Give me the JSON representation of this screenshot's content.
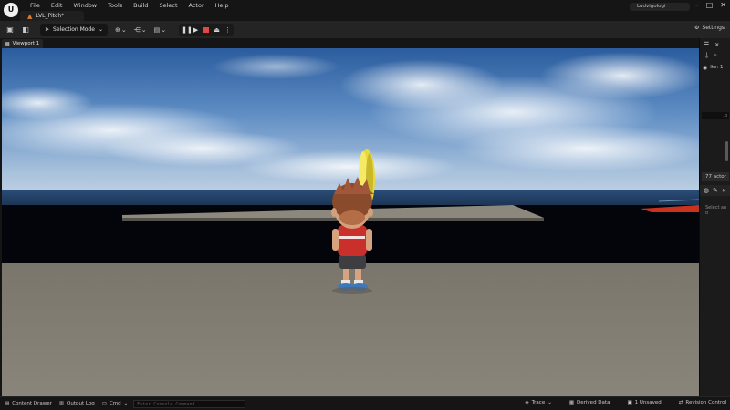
{
  "menu": {
    "items": [
      "File",
      "Edit",
      "Window",
      "Tools",
      "Build",
      "Select",
      "Actor",
      "Help"
    ]
  },
  "level_tab": {
    "name": "LVL_Pitch*"
  },
  "user": {
    "name": "Ludvigologi"
  },
  "toolbar": {
    "mode_label": "Selection Mode",
    "settings_label": "Settings"
  },
  "viewport_tab": {
    "label": "Viewport 1"
  },
  "outliner": {
    "header_label": "Ite: 1",
    "actor_count": "77 actor",
    "filter_value": ".b"
  },
  "details": {
    "hint": "Select an o"
  },
  "statusbar": {
    "content_drawer": "Content Drawer",
    "output_log": "Output Log",
    "cmd": "Cmd",
    "console_placeholder": "Enter Console Command",
    "trace": "Trace",
    "derived_data": "Derived Data",
    "unsaved": "1 Unsaved",
    "revision_control": "Revision Control"
  },
  "colors": {
    "play_stop": "#e04848",
    "level_icon": "#e07a2a",
    "floor": "#7c786e",
    "sky_top": "#2d5fa1",
    "coin": "#e8d93a"
  },
  "icons": {
    "logo": "unreal-logo-icon",
    "window_controls": [
      "minimize-icon",
      "maximize-icon",
      "close-icon"
    ]
  }
}
